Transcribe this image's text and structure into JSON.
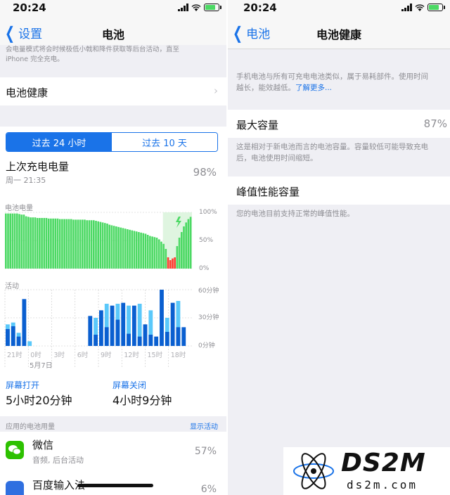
{
  "left": {
    "status": {
      "time": "20:24"
    },
    "nav": {
      "back": "设置",
      "title": "电池"
    },
    "top_note": {
      "line1": "会电量模式将会时候极低小戟和降件获取等后台活动，直至",
      "line2": "iPhone 完全充电。"
    },
    "battery_health_row": "电池健康",
    "segments": {
      "active": "过去 24 小时",
      "inactive": "过去 10 天"
    },
    "last_charge": {
      "label": "上次充电电量",
      "time": "周一 21:35",
      "value": "98%"
    },
    "battery_chart": {
      "label": "电池电量",
      "ticks": [
        "100%",
        "50%",
        "0%"
      ]
    },
    "activity_chart": {
      "label": "活动",
      "ticks": [
        "60分钟",
        "30分钟",
        "0分钟"
      ],
      "x_ticks": [
        "21时",
        "0时",
        "3时",
        "6时",
        "9时",
        "12时",
        "15时",
        "18时"
      ],
      "date_label": "5月7日"
    },
    "screen_on": {
      "label": "屏幕打开",
      "value": "5小时20分钟"
    },
    "screen_off": {
      "label": "屏幕关闭",
      "value": "4小时9分钟"
    },
    "usage_header": {
      "label": "应用的电池用量",
      "action": "显示活动"
    },
    "apps": [
      {
        "name": "微信",
        "detail": "音频, 后台活动",
        "pct": "57%"
      },
      {
        "name": "百度输入法",
        "detail": "",
        "pct": "6%"
      }
    ]
  },
  "right": {
    "status": {
      "time": "20:24"
    },
    "nav": {
      "back": "电池",
      "title": "电池健康"
    },
    "intro": {
      "line1": "手机电池与所有可充电电池类似，属于易耗部件。使用时间",
      "line2": "越长，能效越低。",
      "link": "了解更多..."
    },
    "max_capacity": {
      "label": "最大容量",
      "value": "87%"
    },
    "capacity_note": {
      "line1": "这是相对于新电池而言的电池容量。容量较低可能导致充电",
      "line2": "后，电池使用时间缩短。"
    },
    "peak": {
      "label": "峰值性能容量",
      "note": "您的电池目前支持正常的峰值性能。"
    }
  },
  "watermark": {
    "logo": "DS2M",
    "url": "ds2m.com"
  },
  "chart_data": [
    {
      "type": "bar",
      "title": "电池电量",
      "ylim": [
        0,
        100
      ],
      "ticks": [
        "0%",
        "50%",
        "100%"
      ],
      "values": [
        98,
        98,
        98,
        98,
        98,
        98,
        97,
        96,
        96,
        93,
        92,
        91,
        91,
        91,
        90,
        90,
        90,
        90,
        90,
        89,
        89,
        89,
        89,
        89,
        88,
        88,
        88,
        88,
        88,
        88,
        87,
        87,
        87,
        87,
        87,
        87,
        86,
        86,
        86,
        86,
        85,
        84,
        83,
        82,
        81,
        80,
        78,
        77,
        76,
        75,
        74,
        73,
        72,
        71,
        70,
        69,
        68,
        67,
        66,
        65,
        64,
        63,
        62,
        60,
        58,
        57,
        56,
        55,
        52,
        48,
        44,
        35,
        20,
        15,
        18,
        20,
        40,
        55,
        65,
        75,
        82,
        88,
        92
      ],
      "charging_from_index": 72
    },
    {
      "type": "bar",
      "title": "活动",
      "ylim": [
        0,
        60
      ],
      "ticks": [
        "0分钟",
        "30分钟",
        "60分钟"
      ],
      "categories": [
        "21时",
        "0时",
        "3时",
        "6时",
        "9时",
        "12时",
        "15时",
        "18时"
      ],
      "series": [
        {
          "name": "屏幕打开",
          "values": [
            18,
            21,
            10,
            50,
            0,
            0,
            0,
            0,
            0,
            0,
            0,
            0,
            0,
            0,
            0,
            32,
            12,
            38,
            20,
            43,
            28,
            46,
            13,
            43,
            10,
            23,
            12,
            10,
            60,
            15,
            46,
            20,
            20,
            0
          ]
        },
        {
          "name": "屏幕关闭",
          "values": [
            23,
            25,
            14,
            0,
            5,
            0,
            0,
            0,
            0,
            0,
            0,
            0,
            0,
            0,
            0,
            0,
            30,
            0,
            45,
            0,
            45,
            0,
            43,
            0,
            45,
            0,
            38,
            0,
            0,
            30,
            0,
            48,
            0,
            0
          ]
        }
      ]
    }
  ]
}
